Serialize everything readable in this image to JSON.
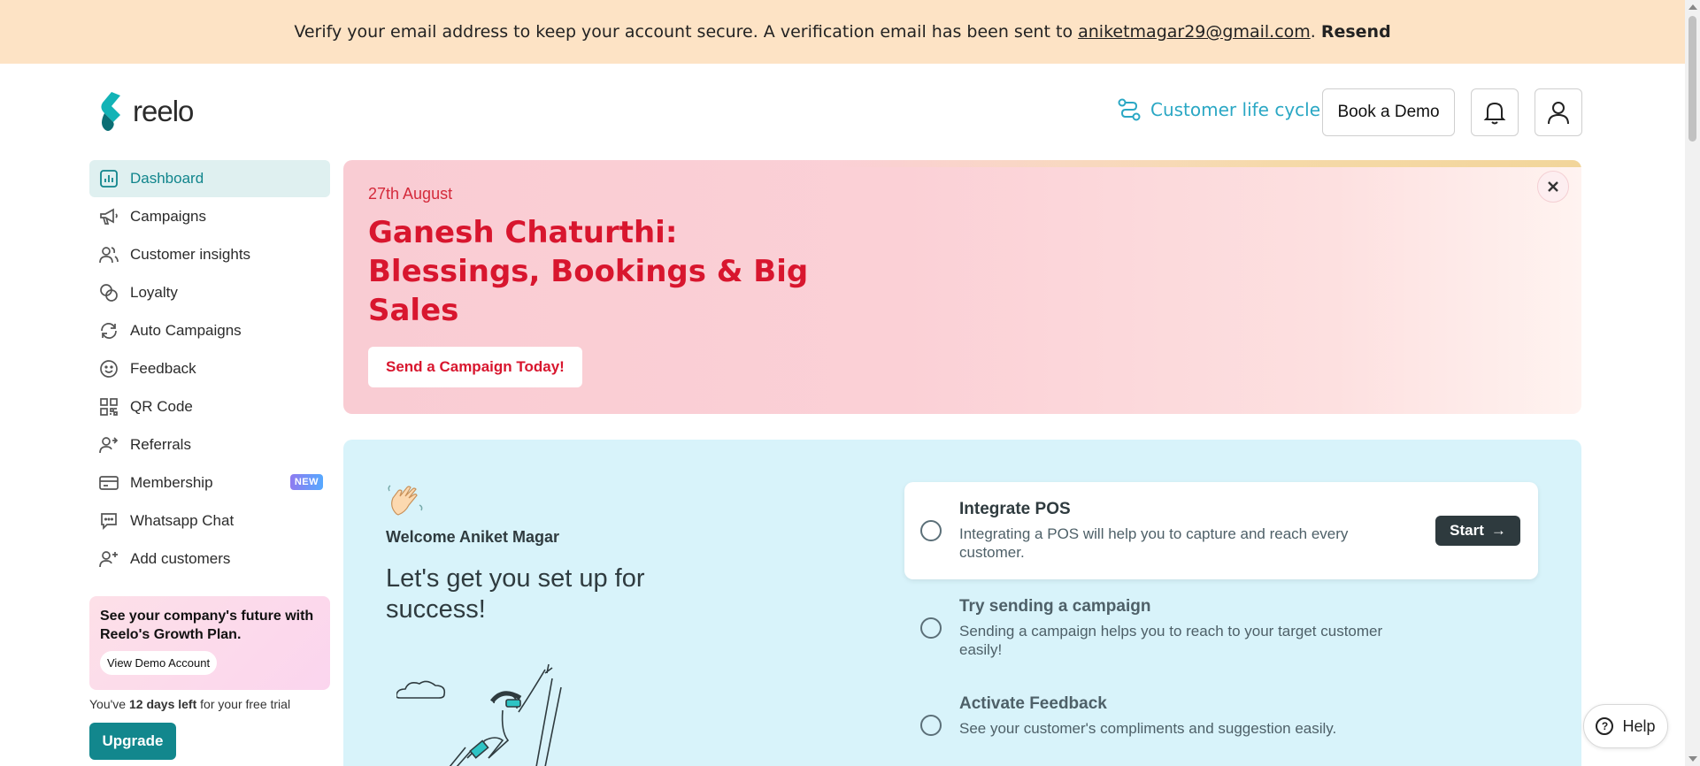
{
  "banner": {
    "message": "Verify your email address to keep your account secure. A verification email has been sent to",
    "email": "aniketmagar29@gmail.com",
    "dot": ".",
    "resend": "Resend"
  },
  "header": {
    "logo_text": "reelo",
    "customer_lifecycle": "Customer life cycle",
    "book_demo": "Book a Demo"
  },
  "sidebar": {
    "items": [
      {
        "label": "Dashboard",
        "icon": "dashboard-icon"
      },
      {
        "label": "Campaigns",
        "icon": "megaphone-icon"
      },
      {
        "label": "Customer insights",
        "icon": "users-icon"
      },
      {
        "label": "Loyalty",
        "icon": "coins-icon"
      },
      {
        "label": "Auto Campaigns",
        "icon": "refresh-icon"
      },
      {
        "label": "Feedback",
        "icon": "smile-icon"
      },
      {
        "label": "QR Code",
        "icon": "qr-code-icon"
      },
      {
        "label": "Referrals",
        "icon": "user-arrow-icon"
      },
      {
        "label": "Membership",
        "icon": "card-icon",
        "badge": "NEW"
      },
      {
        "label": "Whatsapp Chat",
        "icon": "chat-icon"
      },
      {
        "label": "Add customers",
        "icon": "user-plus-icon"
      }
    ],
    "promo_text": "See your company's future with Reelo's Growth Plan.",
    "promo_button": "View Demo Account",
    "trial_prefix": "You've",
    "trial_days": "12 days left",
    "trial_suffix": "for your free trial",
    "upgrade": "Upgrade"
  },
  "hero": {
    "date": "27th August",
    "title": "Ganesh Chaturthi: Blessings, Bookings & Big Sales",
    "cta": "Send a Campaign Today!"
  },
  "setup": {
    "welcome": "Welcome Aniket Magar",
    "headline": "Let's get you set up for success!",
    "tasks": [
      {
        "title": "Integrate POS",
        "desc": "Integrating a POS will help you to capture and reach every customer.",
        "button": "Start"
      },
      {
        "title": "Try sending a campaign",
        "desc": "Sending a campaign helps you to reach to your target customer easily!"
      },
      {
        "title": "Activate Feedback",
        "desc": "See your customer's compliments and suggestion easily."
      }
    ]
  },
  "help": "Help",
  "colors": {
    "accent": "#12878d",
    "banner_bg": "#fde3c5",
    "hero_red": "#d8162e",
    "setup_bg": "#d8f3fa"
  }
}
